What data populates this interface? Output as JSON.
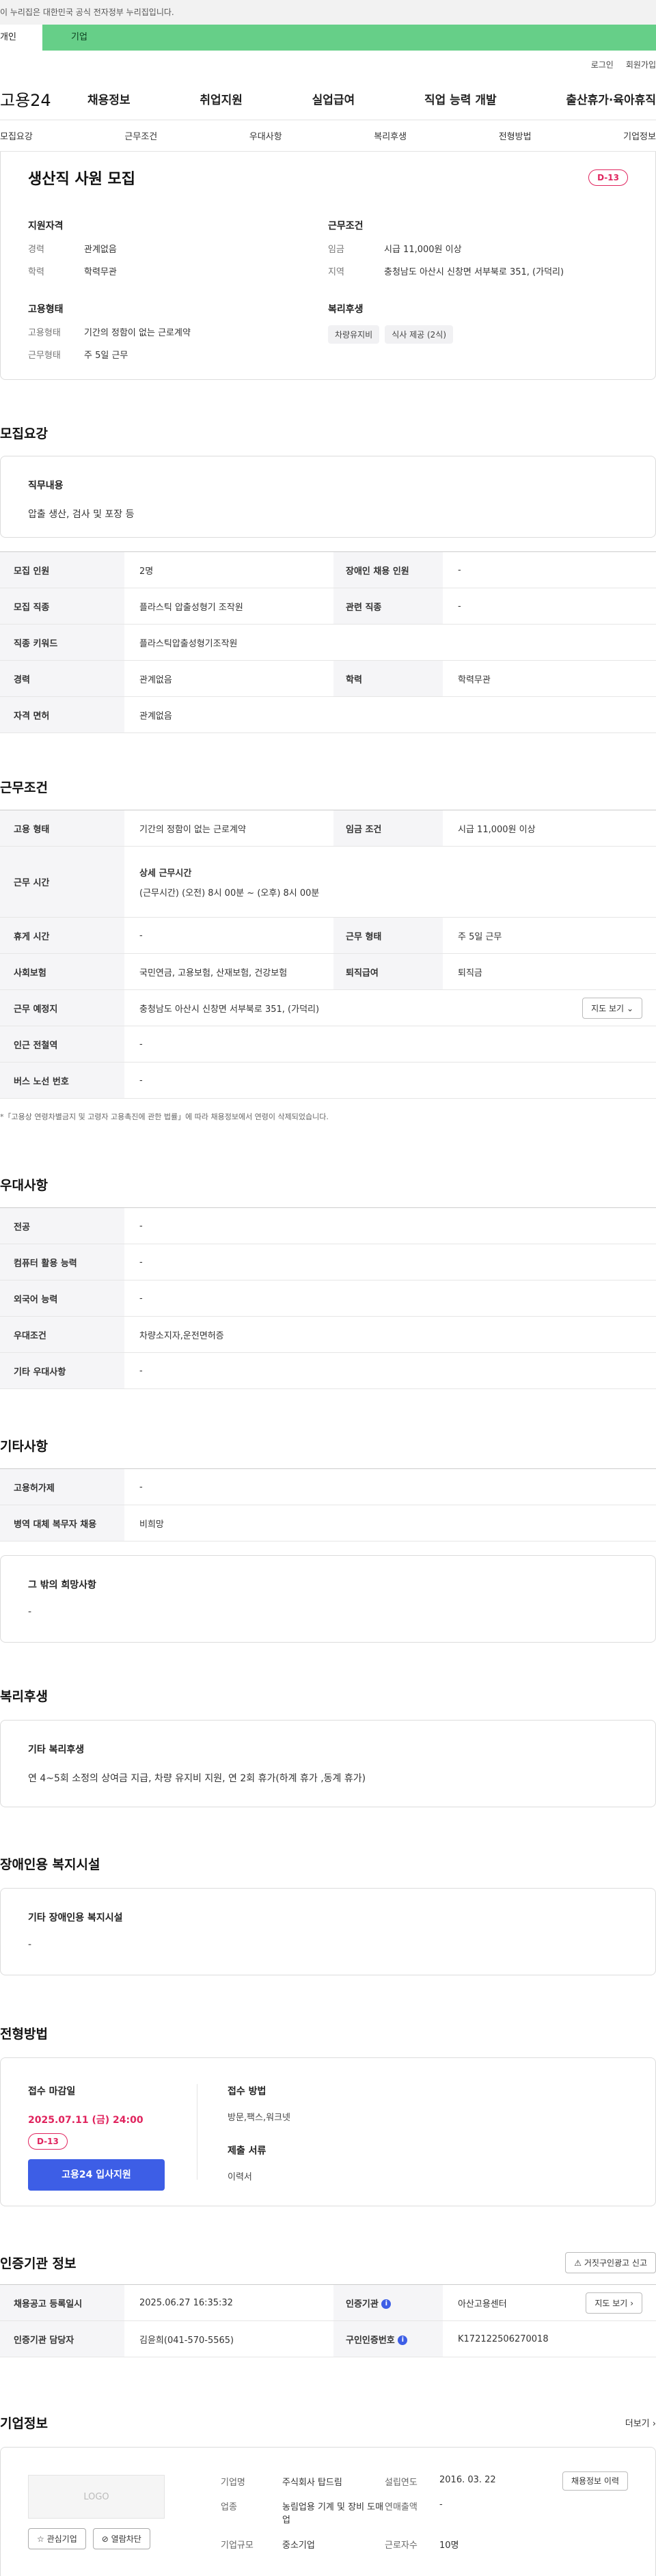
{
  "gov_banner": "이 누리집은 대한민국 공식 전자정부 누리집입니다.",
  "top_tabs": {
    "personal": "개인",
    "company": "기업"
  },
  "util": {
    "login": "로그인",
    "join": "회원가입"
  },
  "site_logo": "고용24",
  "gnb": [
    "채용정보",
    "취업지원",
    "실업급여",
    "직업 능력 개발",
    "출산휴가·육아휴직"
  ],
  "subnav": [
    "모집요강",
    "근무조건",
    "우대사항",
    "복리후생",
    "전형방법",
    "기업정보"
  ],
  "summary": {
    "title": "생산직 사원 모집",
    "dday": "D-13",
    "qual_title": "지원자격",
    "career_k": "경력",
    "career_v": "관계없음",
    "edu_k": "학력",
    "edu_v": "학력무관",
    "emp_title": "고용형태",
    "emptype_k": "고용형태",
    "emptype_v": "기간의 정함이 없는 근로계약",
    "workform_k": "근무형태",
    "workform_v": "주 5일 근무",
    "cond_title": "근무조건",
    "wage_k": "임금",
    "wage_v": "시급 11,000원 이상",
    "region_k": "지역",
    "region_v": "충청남도 아산시 신창면 서부북로 351, (가덕리)",
    "welfare_title": "복리후생",
    "welfare_chips": [
      "차량유지비",
      "식사 제공 (2식)"
    ]
  },
  "recruit": {
    "section_title": "모집요강",
    "job_desc_title": "직무내용",
    "job_desc": "압출 생산, 검사 및 포장 등",
    "rows": [
      {
        "h1": "모집 인원",
        "v1": "2명",
        "h2": "장애인 채용 인원",
        "v2": "-"
      },
      {
        "h1": "모집 직종",
        "v1": "플라스틱 압출성형기 조작원",
        "h2": "관련 직종",
        "v2": "-"
      },
      {
        "h1": "직종 키워드",
        "v1": "플라스틱압출성형기조작원"
      },
      {
        "h1": "경력",
        "v1": "관계없음",
        "h2": "학력",
        "v2": "학력무관"
      },
      {
        "h1": "자격 면허",
        "v1": "관계없음"
      }
    ]
  },
  "work": {
    "section_title": "근무조건",
    "emp_type_h": "고용 형태",
    "emp_type_v": "기간의 정함이 없는 근로계약",
    "wage_h": "임금 조건",
    "wage_v": "시급 11,000원 이상",
    "hours_h": "근무 시간",
    "hours_title": "상세 근무시간",
    "hours_v": "(근무시간) (오전) 8시 00분 ~ (오후) 8시 00분",
    "rest_h": "휴게 시간",
    "rest_v": "-",
    "form_h": "근무 형태",
    "form_v": "주 5일 근무",
    "insurance_h": "사회보험",
    "insurance_v": "국민연금, 고용보험, 산재보험, 건강보험",
    "retire_h": "퇴직급여",
    "retire_v": "퇴직금",
    "place_h": "근무 예정지",
    "place_v": "충청남도 아산시 신창면 서부북로 351, (가덕리)",
    "map_btn": "지도 보기",
    "subway_h": "인근 전철역",
    "subway_v": "-",
    "bus_h": "버스 노선 번호",
    "bus_v": "-",
    "note": "*「고용상 연령차별금지 및 고령자 고용촉진에 관한 법률」에 따라 채용정보에서 연령이 삭제되었습니다."
  },
  "pref": {
    "section_title": "우대사항",
    "rows": [
      {
        "h": "전공",
        "v": "-"
      },
      {
        "h": "컴퓨터 활용 능력",
        "v": "-"
      },
      {
        "h": "외국어 능력",
        "v": "-"
      },
      {
        "h": "우대조건",
        "v": "차량소지자,운전면허증"
      },
      {
        "h": "기타 우대사항",
        "v": "-"
      }
    ]
  },
  "etc": {
    "section_title": "기타사항",
    "rows": [
      {
        "h": "고용허가제",
        "v": "-"
      },
      {
        "h": "병역 대체 복무자 채용",
        "v": "비희망"
      }
    ],
    "other_title": "그 밖의 희망사항",
    "other_v": "-"
  },
  "welfare": {
    "section_title": "복리후생",
    "box_title": "기타 복리후생",
    "box_v": "연 4~5회 소정의 상여금 지급, 차량 유지비 지원, 연 2회 휴가(하계 휴가 ,동계 휴가)"
  },
  "disability": {
    "section_title": "장애인용 복지시설",
    "box_title": "기타 장애인용 복지시설",
    "box_v": "-"
  },
  "selection": {
    "section_title": "전형방법",
    "deadline_label": "접수 마감일",
    "deadline": "2025.07.11 (금) 24:00",
    "dday": "D-13",
    "apply_btn": "고용24 입사지원",
    "method_label": "접수 방법",
    "method_v": "방문,팩스,워크넷",
    "docs_label": "제출 서류",
    "docs_v": "이력서"
  },
  "cert": {
    "section_title": "인증기관 정보",
    "report_btn": "거짓구인광고 신고",
    "reg_h": "채용공고 등록일시",
    "reg_v": "2025.06.27 16:35:32",
    "org_h": "인증기관",
    "org_v": "아산고용센터",
    "map_btn": "지도 보기",
    "manager_h": "인증기관 담당자",
    "manager_v": "김윤희(041-570-5565)",
    "jobno_h": "구인인증번호",
    "jobno_v": "K172122506270018"
  },
  "company": {
    "section_title": "기업정보",
    "more": "더보기",
    "logo": "LOGO",
    "fav_btn": "관심기업",
    "block_btn": "열람차단",
    "name_k": "기업명",
    "name_v": "주식회사 탑드림",
    "industry_k": "업종",
    "industry_v": "농림업용 기계 및 장비 도매업",
    "size_k": "기업규모",
    "size_v": "중소기업",
    "founded_k": "설립연도",
    "founded_v": "2016. 03. 22",
    "sales_k": "연매출액",
    "sales_v": "-",
    "staff_k": "근로자수",
    "staff_v": "10명",
    "history_btn": "채용정보 이력"
  }
}
